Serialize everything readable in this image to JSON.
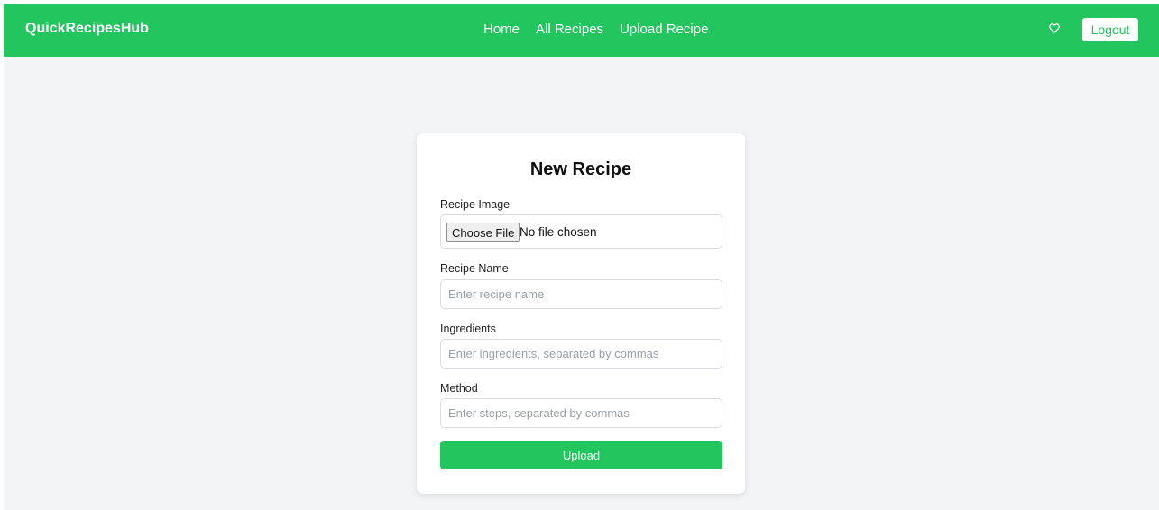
{
  "navbar": {
    "brand": "QuickRecipesHub",
    "links": [
      {
        "label": "Home"
      },
      {
        "label": "All Recipes"
      },
      {
        "label": "Upload Recipe"
      }
    ],
    "favorites_icon": "heart-outline-icon",
    "logout_label": "Logout"
  },
  "form": {
    "title": "New Recipe",
    "image": {
      "label": "Recipe Image",
      "button_label": "Choose File",
      "status": "No file chosen"
    },
    "name": {
      "label": "Recipe Name",
      "value": "",
      "placeholder": "Enter recipe name"
    },
    "ingredients": {
      "label": "Ingredients",
      "value": "",
      "placeholder": "Enter ingredients, separated by commas"
    },
    "method": {
      "label": "Method",
      "value": "",
      "placeholder": "Enter steps, separated by commas"
    },
    "submit_label": "Upload"
  },
  "colors": {
    "accent": "#22c55e",
    "background": "#f3f4f6",
    "card": "#ffffff"
  }
}
